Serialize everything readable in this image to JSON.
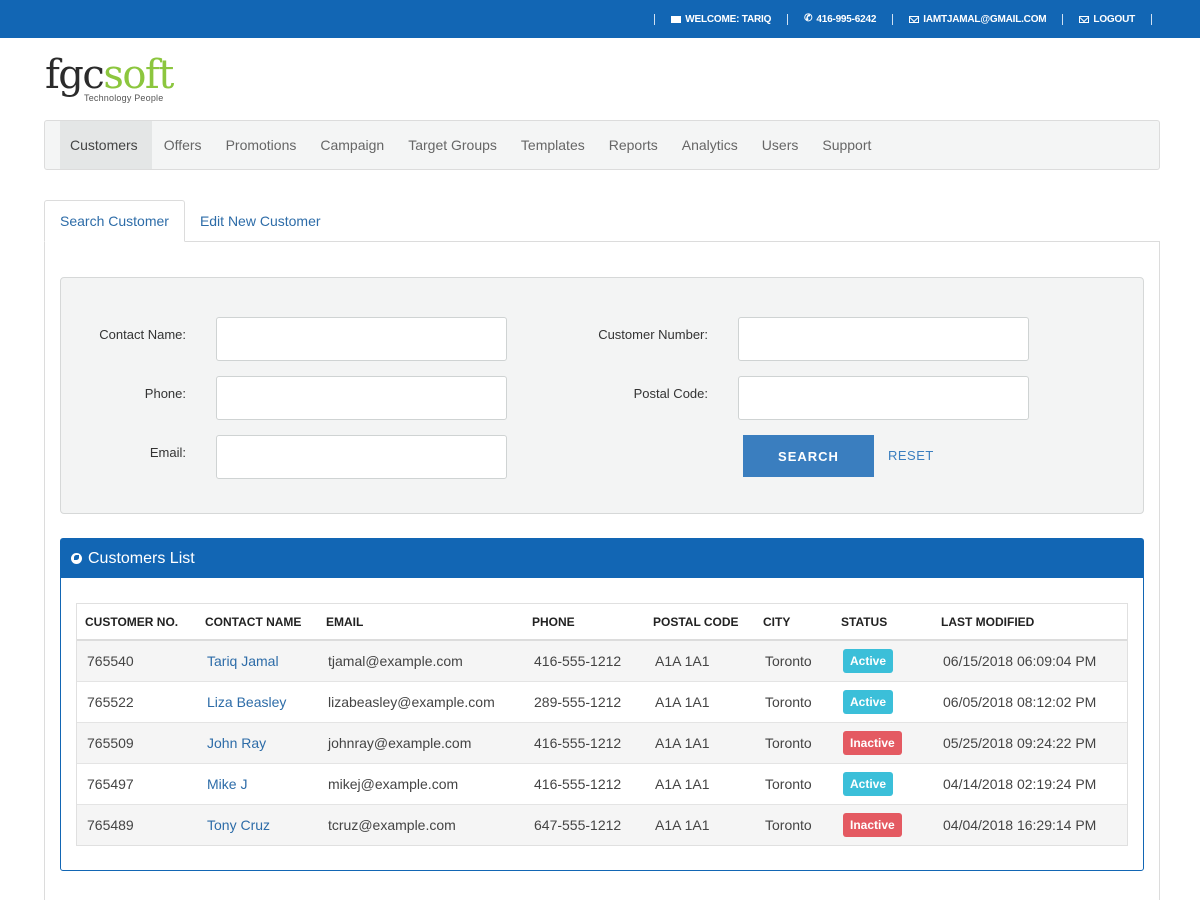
{
  "topbar": {
    "welcome": "WELCOME: TARIQ",
    "phone": "416-995-6242",
    "email": "IAMTJAMAL@GMAIL.COM",
    "logout": "LOGOUT"
  },
  "logo": {
    "part1": "fgc",
    "part2": "soft",
    "tagline": "Technology People",
    "colors": {
      "dark": "#2b2b2b",
      "green": "#8cc63e"
    }
  },
  "nav": {
    "items": [
      {
        "label": "Customers",
        "active": true
      },
      {
        "label": "Offers"
      },
      {
        "label": "Promotions"
      },
      {
        "label": "Campaign"
      },
      {
        "label": "Target Groups"
      },
      {
        "label": "Templates"
      },
      {
        "label": "Reports"
      },
      {
        "label": "Analytics"
      },
      {
        "label": "Users"
      },
      {
        "label": "Support"
      }
    ]
  },
  "tabs": [
    {
      "label": "Search Customer",
      "active": true
    },
    {
      "label": "Edit New Customer"
    }
  ],
  "search": {
    "contact_name_label": "Contact Name:",
    "phone_label": "Phone:",
    "email_label": "Email:",
    "customer_number_label": "Customer Number:",
    "postal_code_label": "Postal Code:",
    "search_label": "SEARCH",
    "reset_label": "RESET"
  },
  "customers_list": {
    "title": "Customers List",
    "columns": [
      "CUSTOMER NO.",
      "CONTACT NAME",
      "EMAIL",
      "PHONE",
      "POSTAL CODE",
      "CITY",
      "STATUS",
      "LAST MODIFIED"
    ],
    "rows": [
      {
        "no": "765540",
        "name": "Tariq Jamal",
        "email": "tjamal@example.com",
        "phone": "416-555-1212",
        "postal": "A1A 1A1",
        "city": "Toronto",
        "status": "Active",
        "modified": "06/15/2018 06:09:04 PM"
      },
      {
        "no": "765522",
        "name": "Liza Beasley",
        "email": "lizabeasley@example.com",
        "phone": "289-555-1212",
        "postal": "A1A 1A1",
        "city": "Toronto",
        "status": "Active",
        "modified": "06/05/2018 08:12:02 PM"
      },
      {
        "no": "765509",
        "name": "John Ray",
        "email": "johnray@example.com",
        "phone": "416-555-1212",
        "postal": "A1A 1A1",
        "city": "Toronto",
        "status": "Inactive",
        "modified": "05/25/2018 09:24:22 PM"
      },
      {
        "no": "765497",
        "name": "Mike J",
        "email": "mikej@example.com",
        "phone": "416-555-1212",
        "postal": "A1A 1A1",
        "city": "Toronto",
        "status": "Active",
        "modified": "04/14/2018 02:19:24 PM"
      },
      {
        "no": "765489",
        "name": "Tony Cruz",
        "email": "tcruz@example.com",
        "phone": "647-555-1212",
        "postal": "A1A 1A1",
        "city": "Toronto",
        "status": "Inactive",
        "modified": "04/04/2018 16:29:14 PM"
      }
    ]
  },
  "colors": {
    "primary": "#1266b4",
    "button": "#3a7ebf",
    "active_badge": "#3bbfd9",
    "inactive_badge": "#e45a62"
  }
}
